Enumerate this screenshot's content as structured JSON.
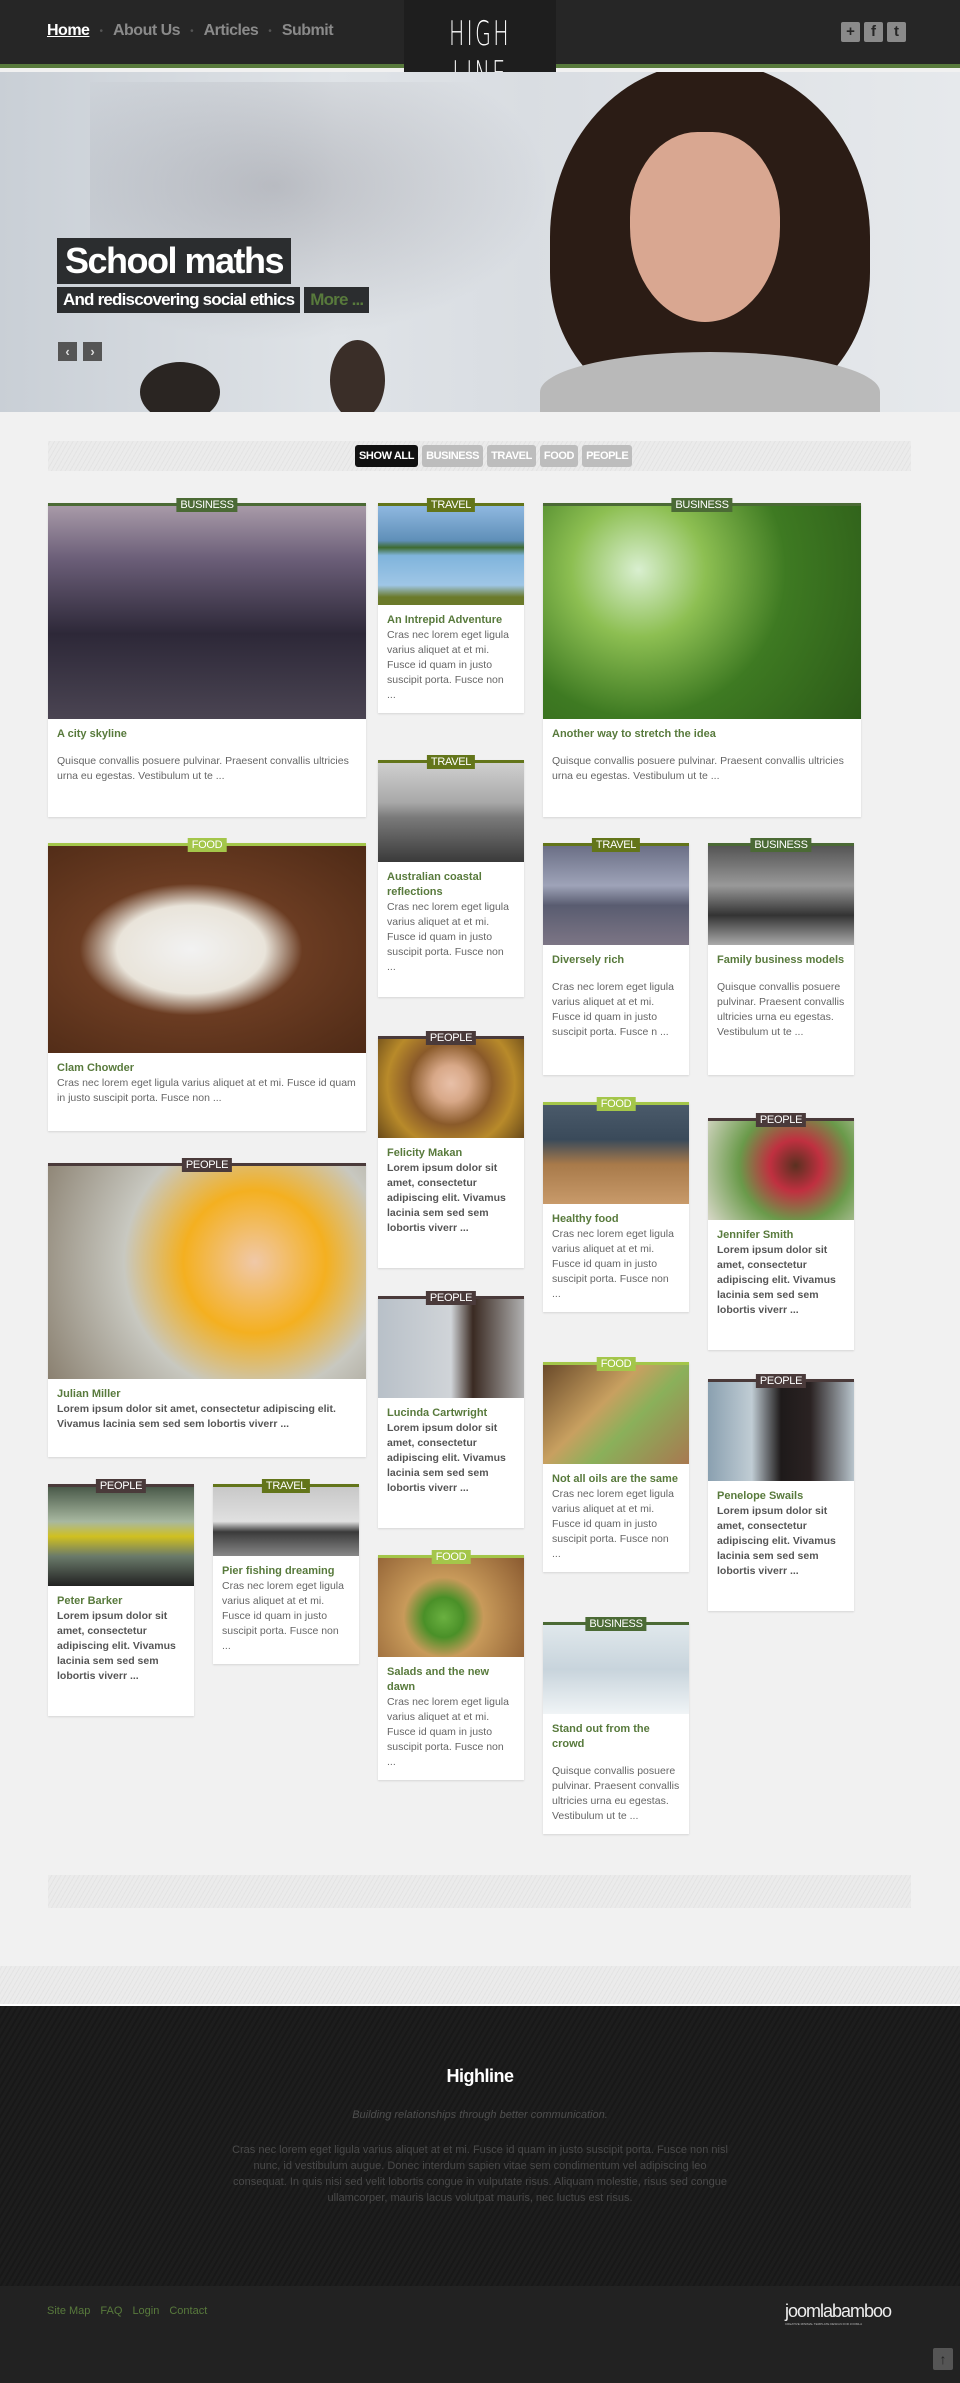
{
  "header": {
    "nav": [
      {
        "label": "Home",
        "active": true
      },
      {
        "label": "About Us"
      },
      {
        "label": "Articles"
      },
      {
        "label": "Submit"
      }
    ],
    "nav_separator": "•",
    "logo": "HIGH LINE",
    "social": [
      {
        "icon": "plus-icon",
        "glyph": "+"
      },
      {
        "icon": "facebook-icon",
        "glyph": "f"
      },
      {
        "icon": "twitter-icon",
        "glyph": "t"
      }
    ]
  },
  "hero": {
    "title": "School maths",
    "subtitle": "And rediscovering social ethics",
    "more": "More ...",
    "prev": "‹",
    "next": "›"
  },
  "filters": [
    "SHOW ALL",
    "BUSINESS",
    "TRAVEL",
    "FOOD",
    "PEOPLE"
  ],
  "colors": {
    "accent": "#587a3c",
    "BUSINESS": "#4b6a35",
    "TRAVEL": "#63751a",
    "FOOD": "#a4c64a",
    "PEOPLE": "#4a3a3a"
  },
  "cards": [
    {
      "category": "BUSINESS",
      "title": "A city skyline",
      "text": "Quisque convallis posuere pulvinar. Praesent convallis ultricies urna eu egestas. Vestibulum ut te ..."
    },
    {
      "category": "TRAVEL",
      "title": "An Intrepid Adventure",
      "text": "Cras nec lorem eget ligula varius aliquet at et mi. Fusce id quam in justo suscipit porta. Fusce non ..."
    },
    {
      "category": "BUSINESS",
      "title": "Another way to stretch the idea",
      "text": "Quisque convallis posuere pulvinar. Praesent convallis ultricies urna eu egestas. Vestibulum ut te ..."
    },
    {
      "category": "TRAVEL",
      "title": "Australian coastal reflections",
      "text": "Cras nec lorem eget ligula varius aliquet at et mi. Fusce id quam in justo suscipit porta. Fusce non ..."
    },
    {
      "category": "FOOD",
      "title": "Clam Chowder",
      "text": "Cras nec lorem eget ligula varius aliquet at et mi. Fusce id quam in justo suscipit porta. Fusce non ..."
    },
    {
      "category": "TRAVEL",
      "title": "Diversely rich",
      "text": "Cras nec lorem eget ligula varius aliquet at et mi. Fusce id quam in justo suscipit porta. Fusce n ..."
    },
    {
      "category": "BUSINESS",
      "title": "Family business models",
      "text": "Quisque convallis posuere pulvinar. Praesent convallis ultricies urna eu egestas. Vestibulum ut te ..."
    },
    {
      "category": "PEOPLE",
      "title": "Felicity Makan",
      "text": "Lorem ipsum dolor sit amet, consectetur adipiscing elit. Vivamus lacinia sem sed sem lobortis viverr ..."
    },
    {
      "category": "FOOD",
      "title": "Healthy food",
      "text": "Cras nec lorem eget ligula varius aliquet at et mi. Fusce id quam in justo suscipit porta. Fusce non ..."
    },
    {
      "category": "PEOPLE",
      "title": "Jennifer Smith",
      "text": "Lorem ipsum dolor sit amet, consectetur adipiscing elit. Vivamus lacinia sem sed sem lobortis viverr ..."
    },
    {
      "category": "PEOPLE",
      "title": "Julian Miller",
      "text": "Lorem ipsum dolor sit amet, consectetur adipiscing elit. Vivamus lacinia sem sed sem lobortis viverr ..."
    },
    {
      "category": "PEOPLE",
      "title": "Lucinda Cartwright",
      "text": "Lorem ipsum dolor sit amet, consectetur adipiscing elit. Vivamus lacinia sem sed sem lobortis viverr ..."
    },
    {
      "category": "FOOD",
      "title": "Not all oils are the same",
      "text": "Cras nec lorem eget ligula varius aliquet at et mi. Fusce id quam in justo suscipit porta. Fusce non ..."
    },
    {
      "category": "PEOPLE",
      "title": "Penelope Swails",
      "text": "Lorem ipsum dolor sit amet, consectetur adipiscing elit. Vivamus lacinia sem sed sem lobortis viverr ..."
    },
    {
      "category": "PEOPLE",
      "title": "Peter Barker",
      "text": "Lorem ipsum dolor sit amet, consectetur adipiscing elit. Vivamus lacinia sem sed sem lobortis viverr ..."
    },
    {
      "category": "TRAVEL",
      "title": "Pier fishing dreaming",
      "text": "Cras nec lorem eget ligula varius aliquet at et mi. Fusce id quam in justo suscipit porta. Fusce non ..."
    },
    {
      "category": "FOOD",
      "title": "Salads and the new dawn",
      "text": "Cras nec lorem eget ligula varius aliquet at et mi. Fusce id quam in justo suscipit porta. Fusce non ..."
    },
    {
      "category": "BUSINESS",
      "title": "Stand out from the crowd",
      "text": "Quisque convallis posuere pulvinar. Praesent convallis ultricies urna eu egestas. Vestibulum ut te ..."
    }
  ],
  "footer": {
    "title": "Highline",
    "tagline": "Building relationships through better communication.",
    "about": "Cras nec lorem eget ligula varius aliquet at et mi. Fusce id quam in justo suscipit porta. Fusce non nisl nunc, id vestibulum augue. Donec interdum sapien vitae sem condimentum vel adipiscing leo consequat. In quis nisi sed velit lobortis congue in vulputate risus. Aliquam molestie, risus sed congue ullamcorper, mauris lacus volutpat mauris, nec luctus est risus.",
    "links": [
      "Site Map",
      "FAQ",
      "Login",
      "Contact"
    ],
    "brand": "joomlabamboo",
    "brand_sub": "CREATIVE MINIMAL TEMPLATE DESIGN FOR JOOMLA",
    "to_top": "↑"
  }
}
